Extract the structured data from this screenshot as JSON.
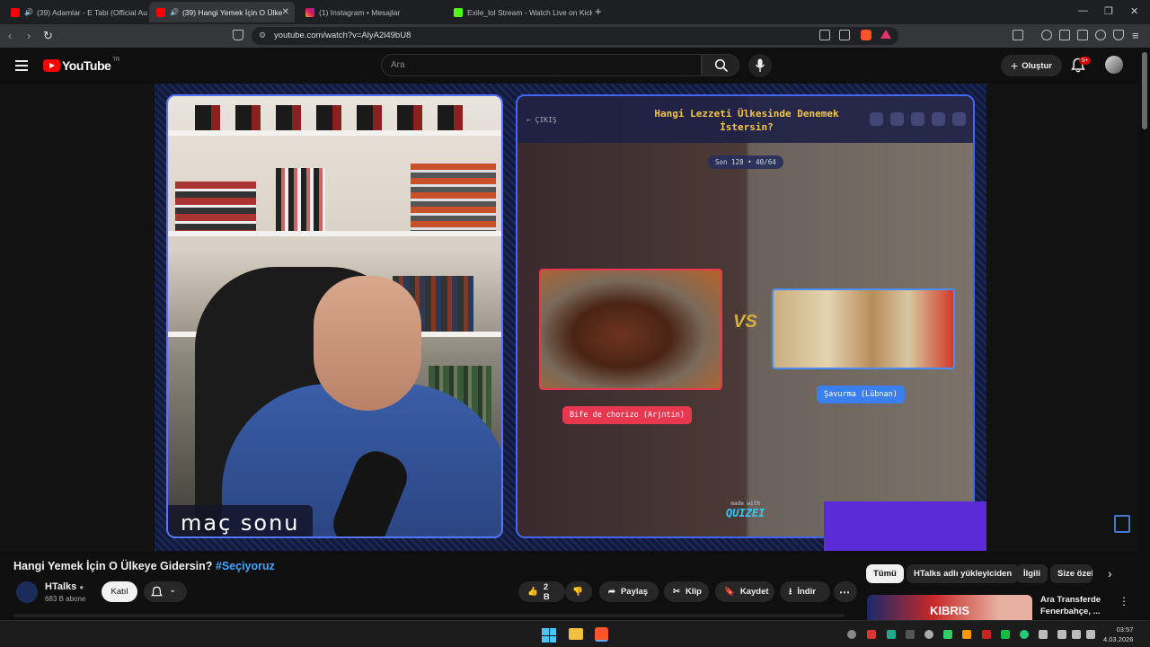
{
  "browser": {
    "tabs": [
      {
        "title": "(39) Adamlar - E Tabi (Official Au",
        "active": false
      },
      {
        "title": "(39) Hangi Yemek İçin O Ülke",
        "active": true
      },
      {
        "title": "(1) Instagram • Mesajlar",
        "active": false
      },
      {
        "title": "Exile_lol Stream - Watch Live on Kick",
        "active": false
      }
    ],
    "url": "youtube.com/watch?v=AlyA2l49bU8"
  },
  "youtube": {
    "logo_text": "YouTube",
    "country_code": "TR",
    "search_placeholder": "Ara",
    "create_label": "Oluştur",
    "notification_count": "9+"
  },
  "video": {
    "overlay_text": "maç sonu",
    "quiz": {
      "back_label": "← ÇIKIŞ",
      "title": "Hangi Lezzeti Ülkesinde Denemek İstersin?",
      "round": "Son 128 • 40/64",
      "option_left": "Bife de chorizo (Arjntin)",
      "option_right": "Şavurma (Lübnan)",
      "vs": "VS",
      "made_with": "made with",
      "brand": "QUIZEI"
    }
  },
  "info": {
    "title": "Hangi Yemek İçin O Ülkeye Gidersin?",
    "hashtag": "#Seçiyoruz",
    "channel": "HTalks",
    "subscribers": "683 B abone",
    "join_label": "Katıl",
    "likes": "2 B",
    "share_label": "Paylaş",
    "clip_label": "Klip",
    "save_label": "Kaydet",
    "download_label": "İndir"
  },
  "related": {
    "chips": [
      "Tümü",
      "HTalks adlı yükleyiciden",
      "İlgili",
      "Size özel"
    ],
    "first_item_title": "Ara Transferde Fenerbahçe, ...",
    "first_item_thumb_text": "KIBRIS"
  },
  "taskbar": {
    "time": "03:57",
    "date": "4.03.2026"
  }
}
